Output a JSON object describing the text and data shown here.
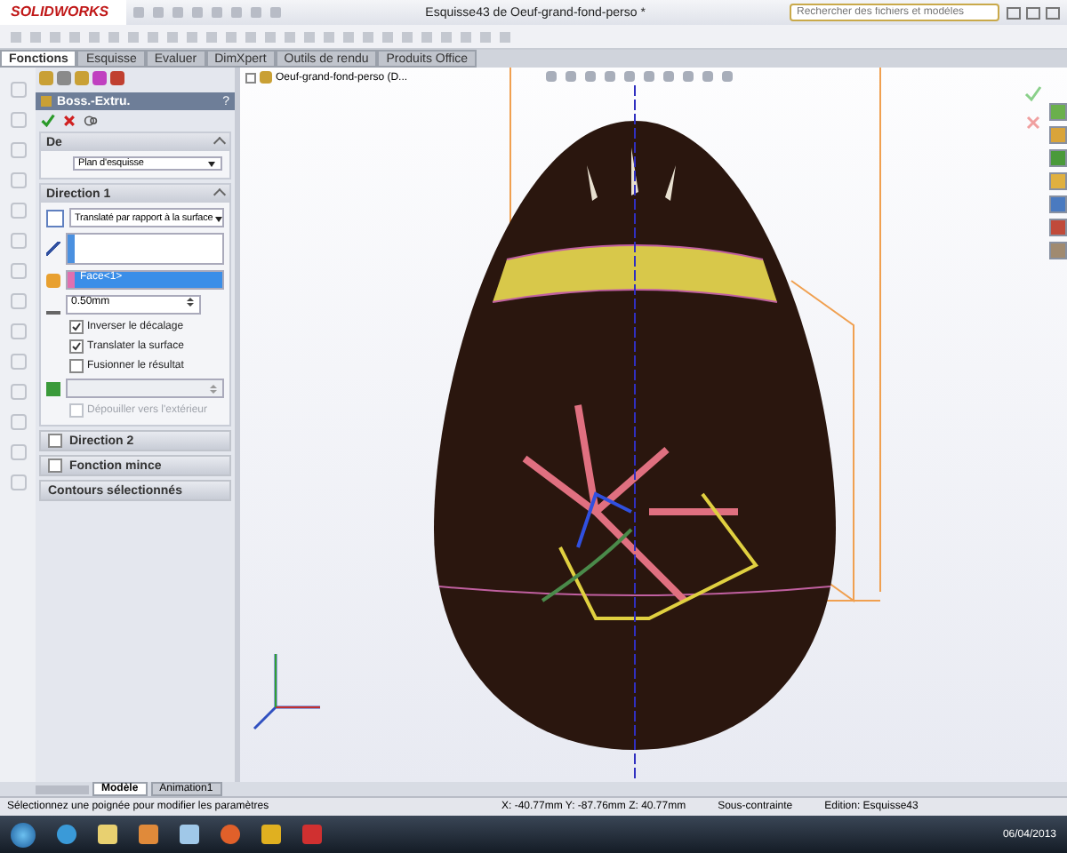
{
  "app": {
    "logo": "SOLIDWORKS",
    "title": "Esquisse43 de Oeuf-grand-fond-perso *",
    "search": {
      "placeholder": "Rechercher des fichiers et modèles"
    }
  },
  "tabs": [
    {
      "label": "Fonctions",
      "selected": true
    },
    {
      "label": "Esquisse",
      "selected": false
    },
    {
      "label": "Evaluer",
      "selected": false
    },
    {
      "label": "DimXpert",
      "selected": false
    },
    {
      "label": "Outils de rendu",
      "selected": false
    },
    {
      "label": "Produits Office",
      "selected": false
    }
  ],
  "feature_tree": {
    "item": "Oeuf-grand-fond-perso  (D..."
  },
  "property_manager": {
    "title": "Boss.-Extru.",
    "help": "?",
    "from": {
      "title": "De",
      "value": "Plan d'esquisse"
    },
    "direction1": {
      "title": "Direction 1",
      "type_value": "Translaté par rapport à la surface",
      "selection": "Face<1>",
      "distance": "0.50mm",
      "options": [
        {
          "label": "Inverser le décalage",
          "checked": true,
          "disabled": false
        },
        {
          "label": "Translater la surface",
          "checked": true,
          "disabled": false
        },
        {
          "label": "Fusionner le résultat",
          "checked": false,
          "disabled": false
        },
        {
          "label": "Dépouiller vers l'extérieur",
          "checked": false,
          "disabled": true
        }
      ]
    },
    "collapsed": [
      {
        "title": "Direction 2",
        "kind": "check",
        "checked": false
      },
      {
        "title": "Fonction mince",
        "kind": "check",
        "checked": false
      },
      {
        "title": "Contours sélectionnés",
        "kind": "plain"
      }
    ]
  },
  "bottom_tabs": [
    {
      "label": "Modèle",
      "selected": true
    },
    {
      "label": "Animation1",
      "selected": false
    }
  ],
  "status_bar": {
    "message": "Sélectionnez une poignée pour modifier les paramètres",
    "coords": "X: -40.77mm Y: -87.76mm Z: 40.77mm",
    "state": "Sous-contrainte",
    "edit": "Edition: Esquisse43"
  },
  "taskbar": {
    "date": "06/04/2013"
  }
}
